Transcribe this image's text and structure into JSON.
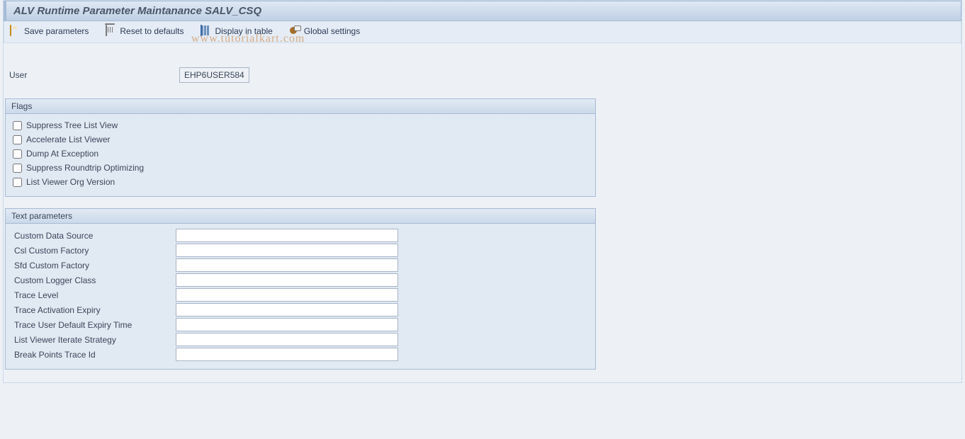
{
  "header": {
    "title": "ALV Runtime Parameter Maintanance SALV_CSQ"
  },
  "toolbar": {
    "save_label": "Save parameters",
    "reset_label": "Reset to defaults",
    "display_label": "Display in table",
    "global_label": "Global settings"
  },
  "watermark": "www.tutorialkart.com",
  "user": {
    "label": "User",
    "value": "EHP6USER584"
  },
  "flags": {
    "title": "Flags",
    "items": [
      {
        "label": "Suppress Tree List View",
        "checked": false
      },
      {
        "label": "Accelerate List Viewer",
        "checked": false
      },
      {
        "label": "Dump At Exception",
        "checked": false
      },
      {
        "label": "Suppress Roundtrip Optimizing",
        "checked": false
      },
      {
        "label": "List Viewer Org Version",
        "checked": false
      }
    ]
  },
  "text_params": {
    "title": "Text parameters",
    "items": [
      {
        "label": "Custom Data Source",
        "value": ""
      },
      {
        "label": "Csl Custom Factory",
        "value": ""
      },
      {
        "label": "Sfd Custom Factory",
        "value": ""
      },
      {
        "label": "Custom Logger Class",
        "value": ""
      },
      {
        "label": "Trace Level",
        "value": ""
      },
      {
        "label": "Trace Activation Expiry",
        "value": ""
      },
      {
        "label": "Trace User Default Expiry Time",
        "value": ""
      },
      {
        "label": "List Viewer Iterate Strategy",
        "value": ""
      },
      {
        "label": "Break Points Trace Id",
        "value": ""
      }
    ]
  }
}
